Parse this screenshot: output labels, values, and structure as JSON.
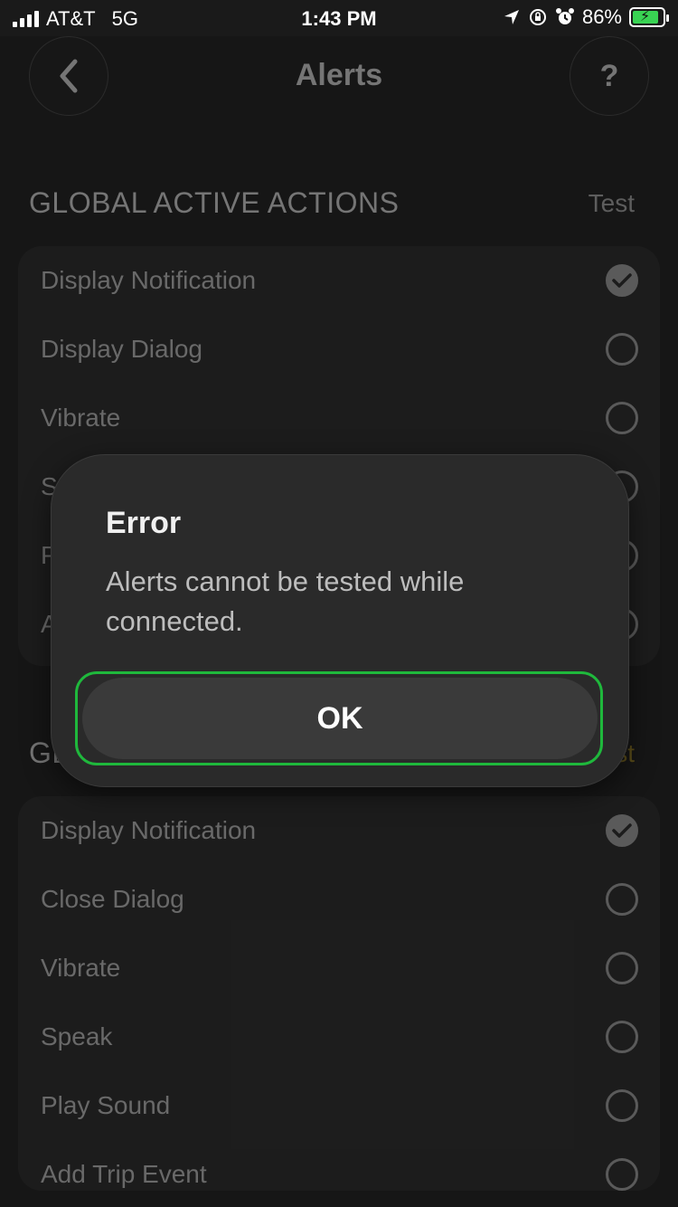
{
  "status_bar": {
    "carrier": "AT&T",
    "network": "5G",
    "time": "1:43 PM",
    "battery": "86%",
    "battery_level": 0.86
  },
  "header": {
    "title": "Alerts",
    "help_label": "?"
  },
  "sections": [
    {
      "title": "GLOBAL ACTIVE ACTIONS",
      "test_label": "Test",
      "items": [
        {
          "label": "Display Notification",
          "checked": true
        },
        {
          "label": "Display Dialog",
          "checked": false
        },
        {
          "label": "Vibrate",
          "checked": false
        },
        {
          "label": "S",
          "checked": false
        },
        {
          "label": "P",
          "checked": false
        },
        {
          "label": "A",
          "checked": false
        }
      ]
    },
    {
      "title": "GL",
      "test_label": "st",
      "items": [
        {
          "label": "Display Notification",
          "checked": true
        },
        {
          "label": "Close Dialog",
          "checked": false
        },
        {
          "label": "Vibrate",
          "checked": false
        },
        {
          "label": "Speak",
          "checked": false
        },
        {
          "label": "Play Sound",
          "checked": false
        },
        {
          "label": "Add Trip Event",
          "checked": false
        }
      ]
    }
  ],
  "dialog": {
    "title": "Error",
    "message": "Alerts cannot be tested while connected.",
    "ok_label": "OK"
  },
  "colors": {
    "background": "#1a1a1a",
    "dialog": "#2a2a2a",
    "ok_highlight": "#1fb83c",
    "battery_fill": "#39d353"
  }
}
